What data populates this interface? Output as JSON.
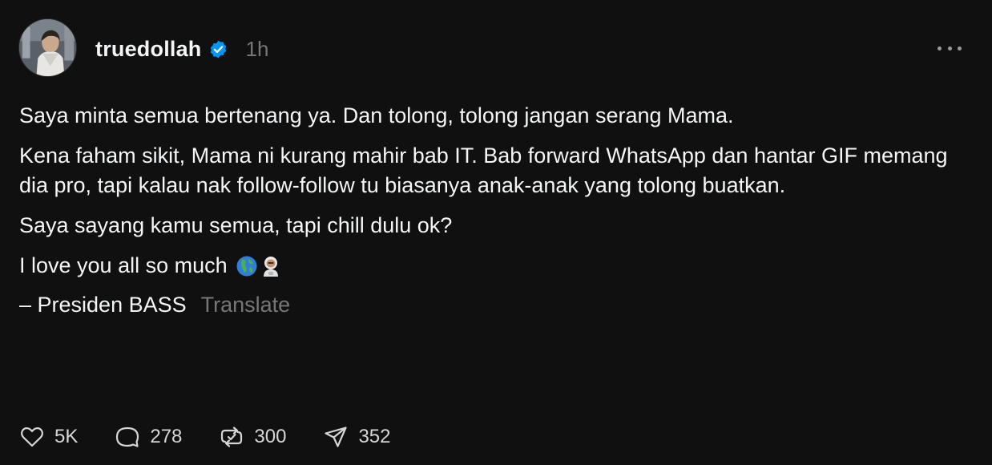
{
  "post": {
    "username": "truedollah",
    "time": "1h",
    "paragraphs": {
      "p1": "Saya minta semua bertenang ya. Dan tolong, tolong jangan serang Mama.",
      "p2": "Kena faham sikit, Mama ni kurang mahir bab IT. Bab forward WhatsApp dan hantar GIF memang dia pro, tapi kalau nak follow-follow tu biasanya anak-anak yang tolong buatkan.",
      "p3": "Saya sayang kamu semua, tapi chill dulu ok?",
      "p4": "I love you all so much",
      "p5": "– Presiden BASS"
    },
    "emojis": [
      "globe-icon",
      "astronaut-icon"
    ],
    "translate_label": "Translate"
  },
  "actions": {
    "likes": "5K",
    "comments": "278",
    "reposts": "300",
    "shares": "352"
  },
  "colors": {
    "background": "#101010",
    "text": "#f3f5f7",
    "muted": "#777777",
    "verified": "#0095f6"
  }
}
